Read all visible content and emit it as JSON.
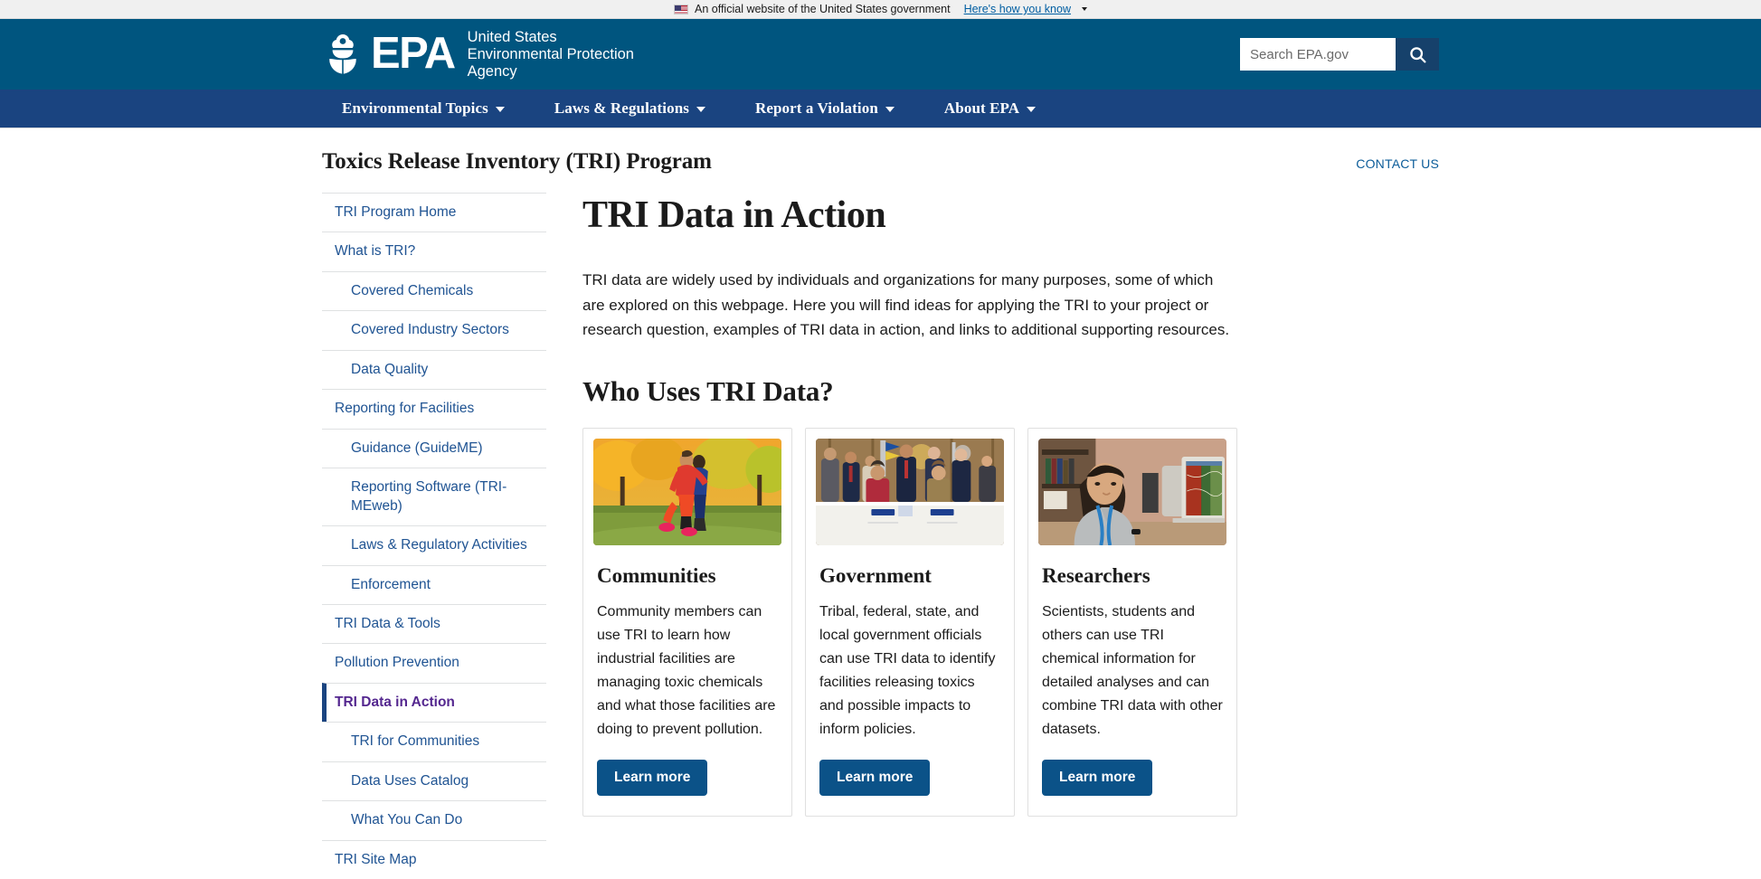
{
  "gov_banner": {
    "flag_icon": "us-flag-icon",
    "text": "An official website of the United States government",
    "link": "Here's how you know",
    "chevron_icon": "chevron-down-icon"
  },
  "header": {
    "seal_icon": "epa-seal-icon",
    "wordmark": "EPA",
    "agency_line_1": "United States",
    "agency_line_2": "Environmental Protection",
    "agency_line_3": "Agency",
    "search": {
      "placeholder": "Search EPA.gov",
      "value": "",
      "button_icon": "search-icon"
    }
  },
  "nav": {
    "items": [
      {
        "label": "Environmental Topics"
      },
      {
        "label": "Laws & Regulations"
      },
      {
        "label": "Report a Violation"
      },
      {
        "label": "About EPA"
      }
    ]
  },
  "program_bar": {
    "title": "Toxics Release Inventory (TRI) Program",
    "contact_label": "CONTACT US"
  },
  "sidebar": {
    "items": [
      {
        "label": "TRI Program Home",
        "level": 1,
        "active": false
      },
      {
        "label": "What is TRI?",
        "level": 1,
        "active": false
      },
      {
        "label": "Covered Chemicals",
        "level": 2,
        "active": false
      },
      {
        "label": "Covered Industry Sectors",
        "level": 2,
        "active": false
      },
      {
        "label": "Data Quality",
        "level": 2,
        "active": false
      },
      {
        "label": "Reporting for Facilities",
        "level": 1,
        "active": false
      },
      {
        "label": "Guidance (GuideME)",
        "level": 2,
        "active": false
      },
      {
        "label": "Reporting Software (TRI-MEweb)",
        "level": 2,
        "active": false
      },
      {
        "label": "Laws & Regulatory Activities",
        "level": 2,
        "active": false
      },
      {
        "label": "Enforcement",
        "level": 2,
        "active": false
      },
      {
        "label": "TRI Data & Tools",
        "level": 1,
        "active": false
      },
      {
        "label": "Pollution Prevention",
        "level": 1,
        "active": false
      },
      {
        "label": "TRI Data in Action",
        "level": 1,
        "active": true
      },
      {
        "label": "TRI for Communities",
        "level": 2,
        "active": false
      },
      {
        "label": "Data Uses Catalog",
        "level": 2,
        "active": false
      },
      {
        "label": "What You Can Do",
        "level": 2,
        "active": false
      },
      {
        "label": "TRI Site Map",
        "level": 1,
        "active": false
      }
    ]
  },
  "main": {
    "page_title": "TRI Data in Action",
    "intro": "TRI data are widely used by individuals and organizations for many purposes, some of which are explored on this webpage. Here you will find ideas for applying the TRI to your project or research question, examples of TRI data in action, and links to additional supporting resources.",
    "section_heading": "Who Uses TRI Data?",
    "cards": [
      {
        "image_name": "joggers-autumn-park-photo",
        "title": "Communities",
        "text": "Community members can use TRI to learn how industrial facilities are managing toxic chemicals and what those facilities are doing to prevent pollution.",
        "button_label": "Learn more"
      },
      {
        "image_name": "government-signing-ceremony-photo",
        "title": "Government",
        "text": "Tribal, federal, state, and local government officials can use TRI data to identify facilities releasing toxics and possible impacts to inform policies.",
        "button_label": "Learn more"
      },
      {
        "image_name": "researcher-at-computer-photo",
        "title": "Researchers",
        "text": "Scientists, students and others can use TRI chemical information for detailed analyses and can combine TRI data with other datasets.",
        "button_label": "Learn more"
      }
    ]
  },
  "colors": {
    "header_blue": "#00557f",
    "nav_blue": "#1a4480",
    "link_blue": "#205493",
    "active_purple": "#54278f",
    "button_blue": "#0b5288",
    "banner_gray": "#f0f0f0"
  }
}
